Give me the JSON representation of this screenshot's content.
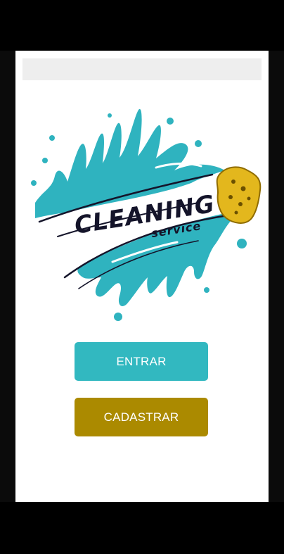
{
  "logo": {
    "title": "CLEANING",
    "subtitle": "service",
    "splash_color": "#2fb3bf",
    "ink_color": "#14142a",
    "sponge_color": "#e3b71d"
  },
  "buttons": {
    "enter_label": "ENTRAR",
    "register_label": "CADASTRAR",
    "enter_color": "#32b8c0",
    "register_color": "#ab8a00"
  }
}
